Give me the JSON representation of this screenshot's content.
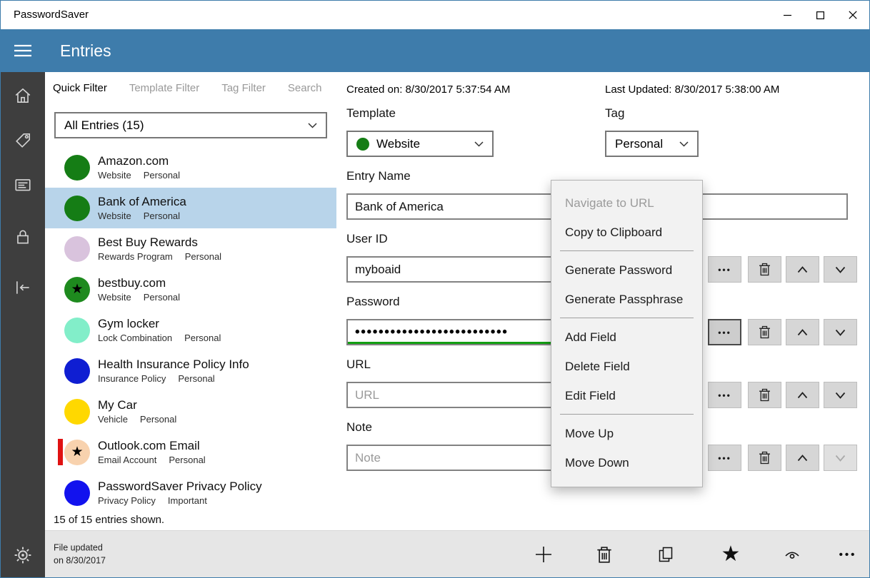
{
  "window": {
    "title": "PasswordSaver",
    "controls": [
      "minimize",
      "maximize",
      "close"
    ]
  },
  "header": {
    "title": "Entries",
    "accent_color": "#3e7cab"
  },
  "nav_rail": {
    "icons": [
      "home",
      "tag",
      "card",
      "lock",
      "exit",
      "settings"
    ]
  },
  "filters": {
    "tabs": [
      {
        "label": "Quick Filter",
        "active": true
      },
      {
        "label": "Template Filter",
        "active": false
      },
      {
        "label": "Tag Filter",
        "active": false
      },
      {
        "label": "Search",
        "active": false
      }
    ]
  },
  "list": {
    "dropdown_value": "All Entries (15)",
    "status": "15 of 15 entries shown."
  },
  "entries": [
    {
      "name": "Amazon.com",
      "template": "Website",
      "tag": "Personal",
      "color": "#157d15",
      "star": false,
      "selected": false,
      "flagged": false
    },
    {
      "name": "Bank of America",
      "template": "Website",
      "tag": "Personal",
      "color": "#157d15",
      "star": false,
      "selected": true,
      "flagged": false
    },
    {
      "name": "Best Buy Rewards",
      "template": "Rewards Program",
      "tag": "Personal",
      "color": "#d9c3dd",
      "star": false,
      "selected": false,
      "flagged": false
    },
    {
      "name": "bestbuy.com",
      "template": "Website",
      "tag": "Personal",
      "color": "#1e8a1e",
      "star": true,
      "selected": false,
      "flagged": false
    },
    {
      "name": "Gym locker",
      "template": "Lock Combination",
      "tag": "Personal",
      "color": "#82eec9",
      "star": false,
      "selected": false,
      "flagged": false
    },
    {
      "name": "Health Insurance Policy Info",
      "template": "Insurance Policy",
      "tag": "Personal",
      "color": "#0f1ed2",
      "star": false,
      "selected": false,
      "flagged": false
    },
    {
      "name": "My Car",
      "template": "Vehicle",
      "tag": "Personal",
      "color": "#ffd800",
      "star": false,
      "selected": false,
      "flagged": false
    },
    {
      "name": "Outlook.com Email",
      "template": "Email Account",
      "tag": "Personal",
      "color": "#f8d2ae",
      "star": true,
      "selected": false,
      "flagged": true
    },
    {
      "name": "PasswordSaver Privacy Policy",
      "template": "Privacy Policy",
      "tag": "Important",
      "color": "#1212ee",
      "star": false,
      "selected": false,
      "flagged": false
    }
  ],
  "detail": {
    "created": "Created on: 8/30/2017 5:37:54 AM",
    "updated": "Last Updated: 8/30/2017 5:38:00 AM",
    "template": {
      "label": "Template",
      "value": "Website",
      "color": "#157d15"
    },
    "tag": {
      "label": "Tag",
      "value": "Personal"
    },
    "entry_name": {
      "label": "Entry Name",
      "value": "Bank of America"
    },
    "user_id": {
      "label": "User ID",
      "value": "myboaid"
    },
    "password": {
      "label": "Password",
      "masked_value": "••••••••••••••••••••••••••",
      "strength_color": "#12a012"
    },
    "url": {
      "label": "URL",
      "placeholder": "URL"
    },
    "note": {
      "label": "Note",
      "placeholder": "Note"
    },
    "row_actions": [
      "more",
      "delete",
      "move-up",
      "move-down"
    ]
  },
  "context_menu": {
    "items": [
      {
        "label": "Navigate to URL",
        "disabled": true
      },
      {
        "label": "Copy to Clipboard"
      },
      {
        "type": "separator"
      },
      {
        "label": "Generate Password"
      },
      {
        "label": "Generate Passphrase"
      },
      {
        "type": "separator"
      },
      {
        "label": "Add Field"
      },
      {
        "label": "Delete Field"
      },
      {
        "label": "Edit Field"
      },
      {
        "type": "separator"
      },
      {
        "label": "Move Up"
      },
      {
        "label": "Move Down"
      }
    ]
  },
  "bottom_bar": {
    "status_line1": "File updated",
    "status_line2": "on 8/30/2017",
    "actions": [
      "add-entry",
      "delete-entry",
      "copy-entry",
      "favorite",
      "reveal",
      "more-options"
    ]
  }
}
